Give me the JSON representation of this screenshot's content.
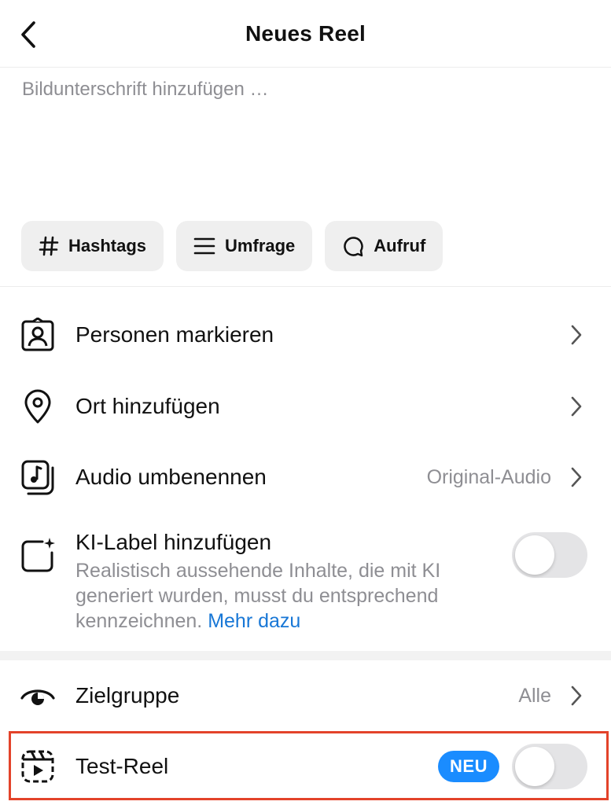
{
  "header": {
    "title": "Neues Reel",
    "back_icon": "chevron-left-icon"
  },
  "caption": {
    "placeholder": "Bildunterschrift hinzufügen …",
    "value": ""
  },
  "chips": [
    {
      "label": "Hashtags",
      "icon": "hashtag-icon"
    },
    {
      "label": "Umfrage",
      "icon": "list-icon"
    },
    {
      "label": "Aufruf",
      "icon": "speech-bubble-icon"
    }
  ],
  "rows": {
    "tag_people": {
      "label": "Personen markieren",
      "icon": "person-tag-icon"
    },
    "location": {
      "label": "Ort hinzufügen",
      "icon": "location-pin-icon"
    },
    "audio": {
      "label": "Audio umbenennen",
      "value": "Original-Audio",
      "icon": "music-note-icon"
    },
    "ai_label": {
      "label": "KI-Label hinzufügen",
      "description": "Realistisch aussehende Inhalte, die mit KI generiert wurden, musst du entsprechend kennzeichnen.",
      "link": "Mehr dazu",
      "enabled": false,
      "icon": "sparkle-square-icon"
    },
    "audience": {
      "label": "Zielgruppe",
      "value": "Alle",
      "icon": "eye-icon"
    },
    "test_reel": {
      "label": "Test-Reel",
      "badge": "NEU",
      "enabled": false,
      "icon": "reel-icon"
    }
  },
  "colors": {
    "accent_link": "#1877d6",
    "badge": "#1a8cff",
    "highlight_border": "#e3432a",
    "toggle_off": "#e4e4e6",
    "muted_text": "#8e8e93"
  }
}
